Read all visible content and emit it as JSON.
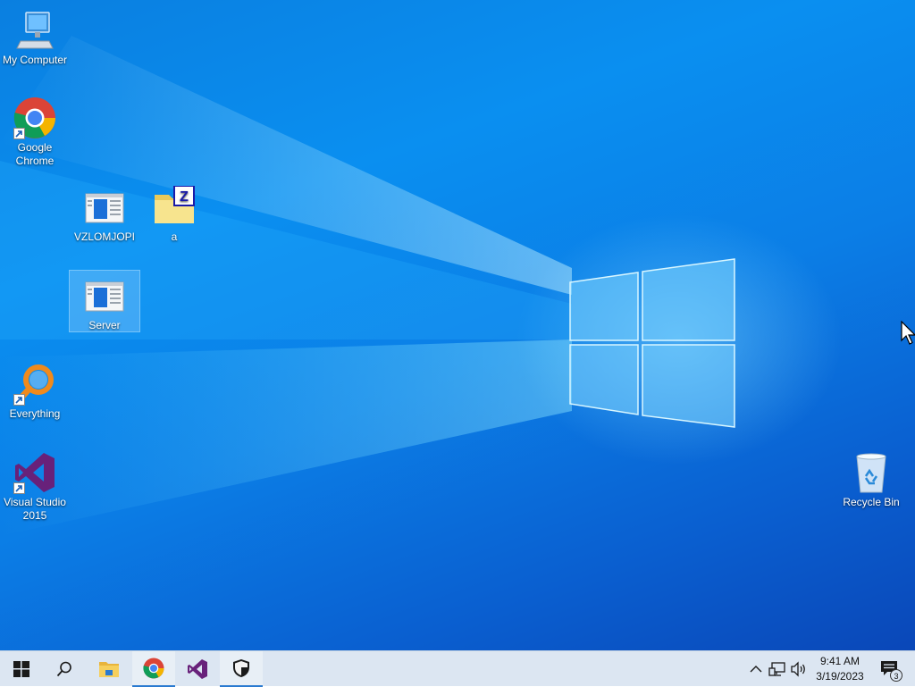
{
  "desktop": {
    "icons": [
      {
        "label": "My Computer",
        "icon": "my-computer-icon"
      },
      {
        "label": "Google\nChrome",
        "icon": "chrome-icon",
        "shortcut": true
      },
      {
        "label": "VZLOMJOPI",
        "icon": "app-window-icon"
      },
      {
        "label": "a",
        "icon": "zip-folder-icon"
      },
      {
        "label": "Server",
        "icon": "app-window-icon",
        "selected": true
      },
      {
        "label": "Everything",
        "icon": "everything-search-icon",
        "shortcut": true
      },
      {
        "label": "Visual Studio\n2015",
        "icon": "visual-studio-icon",
        "shortcut": true
      },
      {
        "label": "Recycle Bin",
        "icon": "recycle-bin-icon"
      }
    ]
  },
  "taskbar": {
    "buttons": [
      {
        "name": "start",
        "icon": "windows-start-icon"
      },
      {
        "name": "search",
        "icon": "search-icon"
      },
      {
        "name": "file-explorer",
        "icon": "file-explorer-icon"
      },
      {
        "name": "chrome",
        "icon": "chrome-icon",
        "active": true
      },
      {
        "name": "visual-studio",
        "icon": "visual-studio-icon"
      },
      {
        "name": "security",
        "icon": "shield-icon",
        "active": true
      }
    ],
    "tray": {
      "icons": [
        "chevron-up-icon",
        "network-icon",
        "volume-icon"
      ],
      "time": "9:41 AM",
      "date": "3/19/2023",
      "notification_count": "3"
    }
  },
  "colors": {
    "desktop_blue": "#0a8ff0",
    "taskbar": "#dce6f2",
    "accent": "#2a7ad0"
  }
}
